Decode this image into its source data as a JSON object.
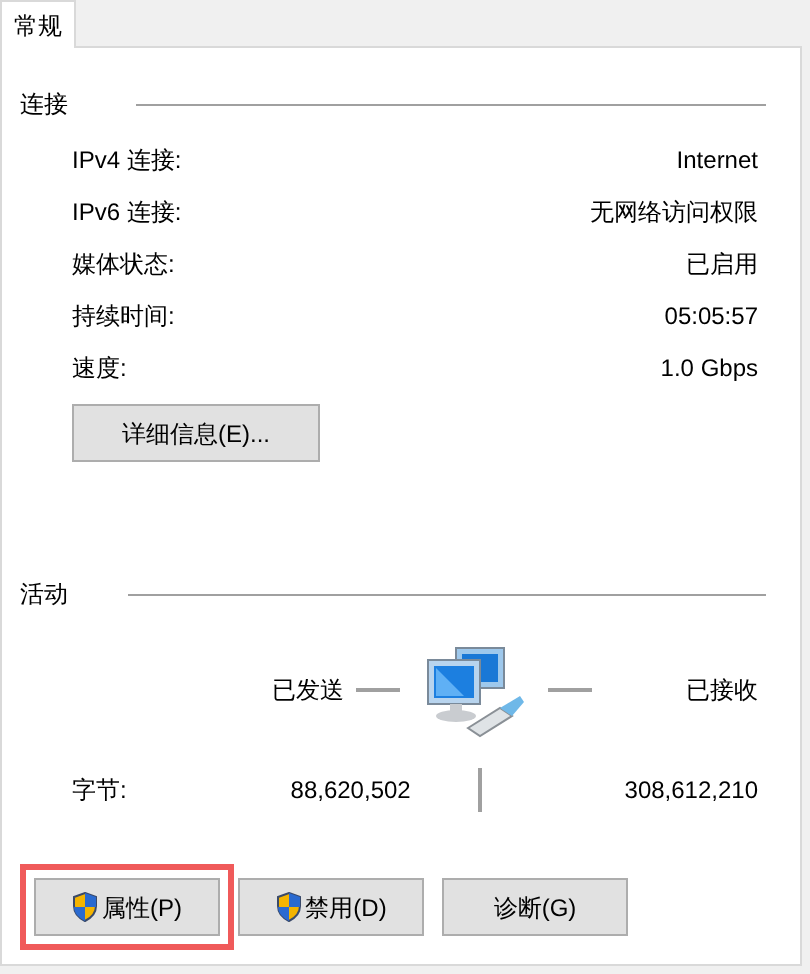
{
  "tabs": [
    {
      "label": "常规",
      "selected": true
    }
  ],
  "connection": {
    "title": "连接",
    "rows": [
      {
        "label": "IPv4 连接:",
        "value": "Internet"
      },
      {
        "label": "IPv6 连接:",
        "value": "无网络访问权限"
      },
      {
        "label": "媒体状态:",
        "value": "已启用"
      },
      {
        "label": "持续时间:",
        "value": "05:05:57"
      },
      {
        "label": "速度:",
        "value": "1.0 Gbps"
      }
    ],
    "details_button": "详细信息(E)..."
  },
  "activity": {
    "title": "活动",
    "sent_label": "已发送",
    "received_label": "已接收",
    "bytes_label": "字节:",
    "bytes_sent": "88,620,502",
    "bytes_received": "308,612,210"
  },
  "buttons": [
    {
      "label": "属性(P)",
      "shield": true,
      "highlighted": true
    },
    {
      "label": "禁用(D)",
      "shield": true,
      "highlighted": false
    },
    {
      "label": "诊断(G)",
      "shield": false,
      "highlighted": false
    }
  ]
}
